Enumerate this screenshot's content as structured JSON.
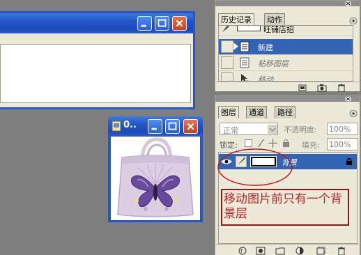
{
  "history": {
    "tabs": [
      "历史记录",
      "动作"
    ],
    "snapshot_label": "旺铺店招",
    "rows": [
      {
        "label": "新建",
        "selected": true
      },
      {
        "label": "粘移图层",
        "selected": false
      },
      {
        "label": "移动",
        "selected": false
      }
    ]
  },
  "layers": {
    "tabs": [
      "图层",
      "通道",
      "路径"
    ],
    "blend_mode": "正常",
    "opacity_label": "不透明度:",
    "opacity_value": "100%",
    "lock_label": "锁定:",
    "fill_label": "填充:",
    "fill_value": "100%",
    "layer_name": "背景",
    "annotation": "移动图片前只有一个背景层"
  },
  "small_window": {
    "title": "0.."
  },
  "colors": {
    "selection": "#3464b4",
    "annotation_text": "#c02020",
    "annotation_border": "#8b1a1a",
    "ellipse": "#c01818"
  }
}
